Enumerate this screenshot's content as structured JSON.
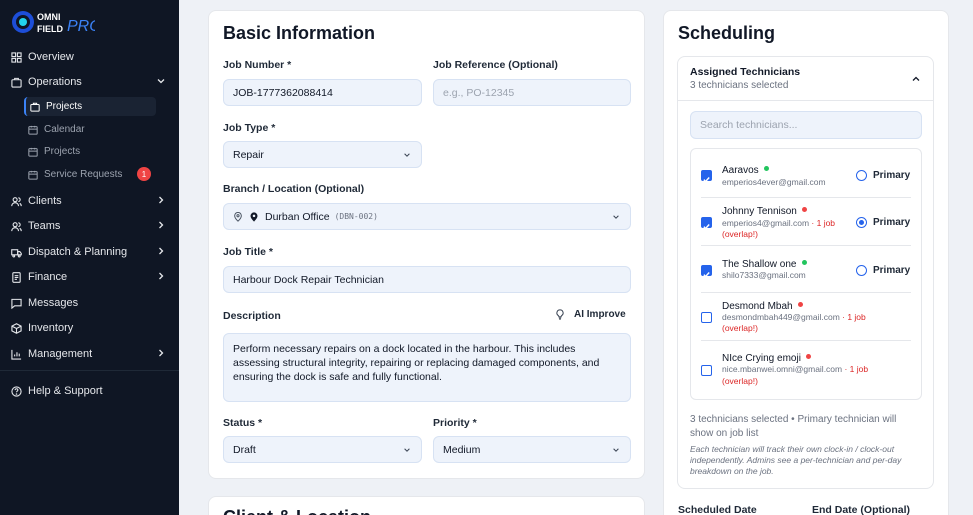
{
  "brand": {
    "line1": "OMNI",
    "line2": "FIELD",
    "line3": "PRO"
  },
  "sidebar": {
    "items": [
      {
        "label": "Overview",
        "icon": "grid-icon"
      },
      {
        "label": "Operations",
        "icon": "briefcase-icon"
      },
      {
        "label": "Clients",
        "icon": "users-icon"
      },
      {
        "label": "Teams",
        "icon": "team-icon"
      },
      {
        "label": "Dispatch & Planning",
        "icon": "truck-icon"
      },
      {
        "label": "Finance",
        "icon": "finance-icon"
      },
      {
        "label": "Messages",
        "icon": "message-icon"
      },
      {
        "label": "Inventory",
        "icon": "box-icon"
      },
      {
        "label": "Management",
        "icon": "chart-icon"
      },
      {
        "label": "Help & Support",
        "icon": "help-icon"
      }
    ],
    "sub_items": [
      {
        "label": "Projects",
        "icon": "briefcase-icon"
      },
      {
        "label": "Calendar",
        "icon": "calendar-icon"
      },
      {
        "label": "Projects",
        "icon": "calendar-icon"
      },
      {
        "label": "Service Requests",
        "icon": "calendar-icon",
        "badge": "1"
      }
    ]
  },
  "basic": {
    "title": "Basic Information",
    "job_number_label": "Job Number *",
    "job_number_value": "JOB-1777362088414",
    "job_ref_label": "Job Reference (Optional)",
    "job_ref_placeholder": "e.g., PO-12345",
    "job_type_label": "Job Type *",
    "job_type_value": "Repair",
    "branch_label": "Branch / Location (Optional)",
    "branch_value": "Durban Office",
    "branch_code": "(DBN-002)",
    "job_title_label": "Job Title *",
    "job_title_value": "Harbour Dock Repair Technician",
    "description_label": "Description",
    "ai_improve_label": "AI Improve",
    "description_value": "Perform necessary repairs on a dock located in the harbour. This includes assessing structural integrity, repairing or replacing damaged components, and ensuring the dock is safe and fully functional.",
    "status_label": "Status *",
    "status_value": "Draft",
    "priority_label": "Priority *",
    "priority_value": "Medium"
  },
  "client_location": {
    "title": "Client & Location"
  },
  "scheduling": {
    "title": "Scheduling",
    "assigned_title": "Assigned Technicians",
    "assigned_sub": "3 technicians selected",
    "search_placeholder": "Search technicians...",
    "primary_label": "Primary",
    "technicians": [
      {
        "name": "Aaravos",
        "email": "emperios4ever@gmail.com",
        "jobs": "",
        "overlap": "",
        "status_color": "#22c55e",
        "checked": true,
        "primary": false
      },
      {
        "name": "Johnny Tennison",
        "email": "emperios4@gmail.com",
        "jobs": " · 1 job",
        "overlap": "(overlap!)",
        "status_color": "#ef4444",
        "checked": true,
        "primary": true
      },
      {
        "name": "The Shallow one",
        "email": "shilo7333@gmail.com",
        "jobs": "",
        "overlap": "",
        "status_color": "#22c55e",
        "checked": true,
        "primary": false
      },
      {
        "name": "Desmond Mbah",
        "email": "desmondmbah449@gmail.com",
        "jobs": " · 1 job",
        "overlap": "(overlap!)",
        "status_color": "#ef4444",
        "checked": false,
        "primary": null
      },
      {
        "name": "NIce Crying emoji",
        "email": "nice.mbanwei.omni@gmail.com",
        "jobs": " · 1 job",
        "overlap": "(overlap!)",
        "status_color": "#ef4444",
        "checked": false,
        "primary": null
      }
    ],
    "summary": "3 technicians selected • Primary technician will show on job list",
    "note": "Each technician will track their own clock-in / clock-out independently. Admins see a per-technician and per-day breakdown on the job.",
    "scheduled_date_label": "Scheduled Date",
    "end_date_label": "End Date (Optional)"
  }
}
